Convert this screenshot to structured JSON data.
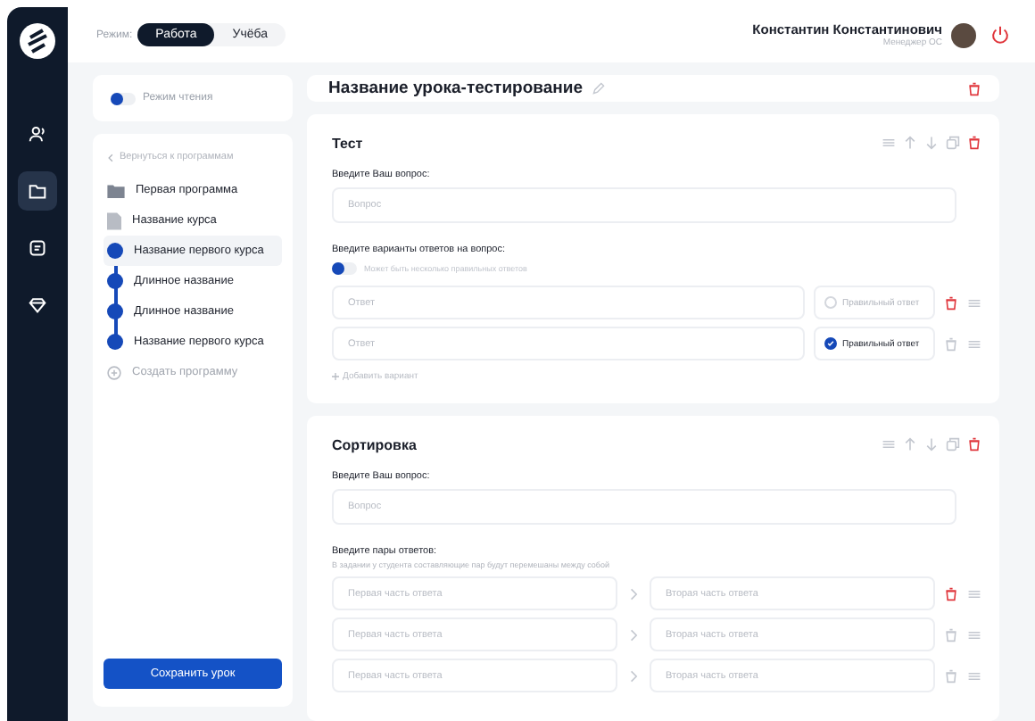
{
  "header": {
    "mode_label": "Режим:",
    "modes": [
      {
        "label": "Работа",
        "selected": true
      },
      {
        "label": "Учёба",
        "selected": false
      }
    ],
    "user": {
      "name": "Константин Константинович",
      "role": "Менеджер ОС"
    }
  },
  "sidebar": {
    "items": [
      {
        "kind": "users",
        "selected": false
      },
      {
        "kind": "folder",
        "selected": true
      },
      {
        "kind": "notes",
        "selected": false
      },
      {
        "kind": "diamond",
        "selected": false
      }
    ]
  },
  "reading_mode": {
    "label": "Режим чтения",
    "on": false
  },
  "navigation": {
    "back": "Вернуться к программам",
    "program": "Первая программа",
    "course": "Название курса",
    "lessons": [
      {
        "label": "Название первого курса",
        "selected": true
      },
      {
        "label": "Длинное название",
        "selected": false
      },
      {
        "label": "Длинное название",
        "selected": false
      },
      {
        "label": "Название первого курса",
        "selected": false
      }
    ],
    "create": "Создать программу"
  },
  "save_button": "Сохранить урок",
  "lesson": {
    "title": "Название урока-тестирование"
  },
  "blocks": [
    {
      "kind": "test",
      "title": "Тест",
      "question_label": "Введите Ваш вопрос:",
      "question_placeholder": "Вопрос",
      "answers_label": "Введите варианты ответов на вопрос:",
      "multiple": {
        "label": "Может быть несколько правильных ответов",
        "on": false
      },
      "options": [
        {
          "placeholder": "Ответ",
          "correct_label": "Правильный ответ",
          "checked": false,
          "removable": true
        },
        {
          "placeholder": "Ответ",
          "correct_label": "Правильный ответ",
          "checked": true,
          "removable": false
        }
      ],
      "add_label": "Добавить вариант"
    },
    {
      "kind": "sorting",
      "title": "Сортировка",
      "question_label": "Введите Ваш вопрос:",
      "question_placeholder": "Вопрос",
      "pairs_label": "Введите пары ответов:",
      "pairs_hint": "В задании у студента составляющие пар будут перемешаны между собой",
      "pairs": [
        {
          "first_placeholder": "Первая часть ответа",
          "second_placeholder": "Вторая часть ответа",
          "removable": true
        },
        {
          "first_placeholder": "Первая часть ответа",
          "second_placeholder": "Вторая часть ответа",
          "removable": false
        },
        {
          "first_placeholder": "Первая часть ответа",
          "second_placeholder": "Вторая часть ответа",
          "removable": false
        }
      ]
    }
  ]
}
